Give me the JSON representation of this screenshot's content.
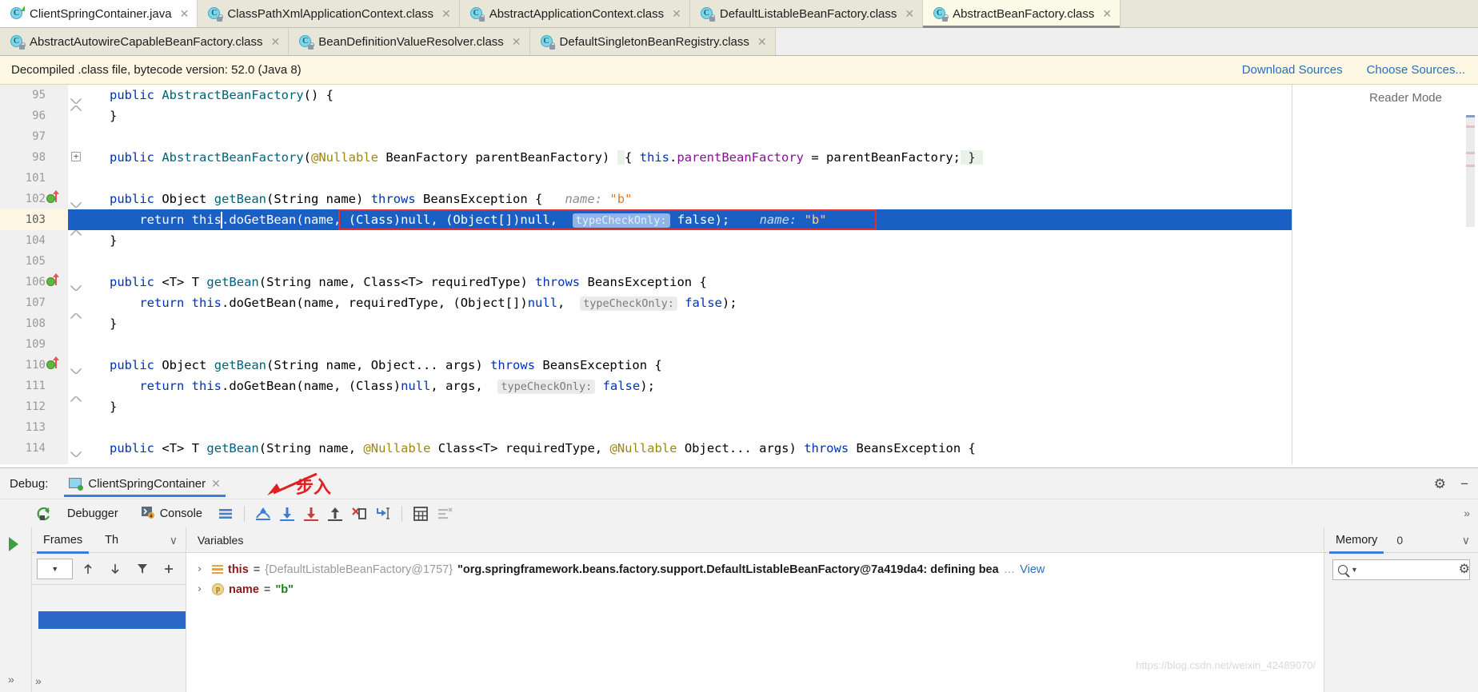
{
  "window": {
    "tabs_row1": [
      {
        "label": "ClientSpringContainer.java",
        "icon": "java-class-run-icon",
        "state": "active"
      },
      {
        "label": "ClassPathXmlApplicationContext.class",
        "icon": "java-class-locked-icon",
        "state": "inactive"
      },
      {
        "label": "AbstractApplicationContext.class",
        "icon": "java-class-locked-icon",
        "state": "inactive"
      },
      {
        "label": "DefaultListableBeanFactory.class",
        "icon": "java-class-locked-icon",
        "state": "inactive"
      },
      {
        "label": "AbstractBeanFactory.class",
        "icon": "java-class-locked-icon",
        "state": "selected"
      }
    ],
    "tabs_row2": [
      {
        "label": "AbstractAutowireCapableBeanFactory.class",
        "icon": "java-class-locked-icon",
        "state": "inactive"
      },
      {
        "label": "BeanDefinitionValueResolver.class",
        "icon": "java-class-locked-icon",
        "state": "inactive"
      },
      {
        "label": "DefaultSingletonBeanRegistry.class",
        "icon": "java-class-locked-icon",
        "state": "inactive"
      }
    ],
    "close_glyph": "✕"
  },
  "banner": {
    "message": "Decompiled .class file, bytecode version: 52.0 (Java 8)",
    "download_sources": "Download Sources",
    "choose_sources": "Choose Sources..."
  },
  "editor": {
    "reader_mode_label": "Reader Mode",
    "line_numbers": [
      "95",
      "96",
      "97",
      "98",
      "101",
      "102",
      "103",
      "104",
      "105",
      "106",
      "107",
      "108",
      "109",
      "110",
      "111",
      "112",
      "113",
      "114"
    ],
    "breakpoint_lines": [
      "102",
      "106",
      "110"
    ],
    "highlighted_line": "103",
    "lines": [
      {
        "num": "95",
        "text": "public AbstractBeanFactory() {"
      },
      {
        "num": "96",
        "text": "}"
      },
      {
        "num": "97",
        "text": ""
      },
      {
        "num": "98",
        "text": "public AbstractBeanFactory(@Nullable BeanFactory parentBeanFactory) { this.parentBeanFactory = parentBeanFactory; }"
      },
      {
        "num": "101",
        "text": ""
      },
      {
        "num": "102",
        "text": "public Object getBean(String name) throws BeansException {   name: \"b\""
      },
      {
        "num": "103",
        "text": "return this.doGetBean(name, (Class)null, (Object[])null,  typeCheckOnly: false);    name: \"b\""
      },
      {
        "num": "104",
        "text": "}"
      },
      {
        "num": "105",
        "text": ""
      },
      {
        "num": "106",
        "text": "public <T> T getBean(String name, Class<T> requiredType) throws BeansException {"
      },
      {
        "num": "107",
        "text": "return this.doGetBean(name, requiredType, (Object[])null,  typeCheckOnly: false);"
      },
      {
        "num": "108",
        "text": "}"
      },
      {
        "num": "109",
        "text": ""
      },
      {
        "num": "110",
        "text": "public Object getBean(String name, Object... args) throws BeansException {"
      },
      {
        "num": "111",
        "text": "return this.doGetBean(name, (Class)null, args,  typeCheckOnly: false);"
      },
      {
        "num": "112",
        "text": "}"
      },
      {
        "num": "113",
        "text": ""
      },
      {
        "num": "114",
        "text": "public <T> T getBean(String name, @Nullable Class<T> requiredType, @Nullable Object... args) throws BeansException {"
      }
    ],
    "param_hint_typecheckonly": "typeCheckOnly:",
    "param_hint_name": "name:",
    "inline_value_b": "\"b\""
  },
  "debug": {
    "label": "Debug:",
    "session_name": "ClientSpringContainer",
    "annotation_cn": "步入",
    "toolbar": {
      "rerun_icon": "rerun-icon",
      "tabs": [
        {
          "label": "Debugger",
          "icon": "debugger-icon",
          "selected": true
        },
        {
          "label": "Console",
          "icon": "console-icon",
          "selected": false
        }
      ],
      "buttons": [
        {
          "name": "layout-icon",
          "glyph": "☰"
        },
        {
          "name": "step-over-icon",
          "glyph": "↗"
        },
        {
          "name": "step-into-icon",
          "glyph": "↓"
        },
        {
          "name": "force-step-into-icon",
          "glyph": "↓"
        },
        {
          "name": "step-out-icon",
          "glyph": "↑"
        },
        {
          "name": "drop-frame-icon",
          "glyph": "✗"
        },
        {
          "name": "run-to-cursor-icon",
          "glyph": "↳"
        },
        {
          "name": "evaluate-expression-icon",
          "glyph": "▦"
        },
        {
          "name": "mute-breakpoints-icon",
          "glyph": "≡"
        }
      ],
      "settings_glyph": "⚙",
      "collapse_glyph": "−"
    },
    "frames_pane": {
      "tabs": [
        {
          "label": "Frames",
          "selected": true
        },
        {
          "label": "Th",
          "selected": false
        }
      ],
      "dropdown_glyph": "∨",
      "toolbar": {
        "thread_combo_glyph": "▼",
        "up_glyph": "↑",
        "down_glyph": "↓",
        "filter_glyph": "ᐳ",
        "add_glyph": "+"
      }
    },
    "variables_pane": {
      "title": "Variables",
      "rows": [
        {
          "chevron": "›",
          "icon": "object-field-icon",
          "name": "this",
          "eq": "=",
          "ref": "{DefaultListableBeanFactory@1757}",
          "value": "\"org.springframework.beans.factory.support.DefaultListableBeanFactory@7a419da4: defining bea",
          "ellipsis": "…",
          "view_link": "View"
        },
        {
          "chevron": "›",
          "icon": "parameter-icon",
          "icon_letter": "p",
          "name": "name",
          "eq": "=",
          "ref": "",
          "value": "\"b\"",
          "ellipsis": "",
          "view_link": ""
        }
      ]
    },
    "memory_pane": {
      "tab_label": "Memory",
      "count": "0",
      "dropdown_glyph": "∨",
      "search_placeholder": "",
      "search_glyph": "Q",
      "gear_glyph": "⚙"
    },
    "left_strip": {
      "resume_glyph": "▶",
      "expand_glyph": "»"
    }
  },
  "watermark": "https://blog.csdn.net/weixin_42489070/",
  "colors": {
    "banner_bg": "#fcf8e3",
    "tab_bg": "#e8e6d8",
    "selection_blue": "#1a5fc4",
    "link_blue": "#2a6ebb",
    "red_box": "#e03030",
    "keyword": "#0033b3",
    "method": "#00627a",
    "field": "#871094",
    "annotation": "#9e880d",
    "string": "#e07a1a",
    "accent_tab_underline": "#3b7dd8"
  }
}
